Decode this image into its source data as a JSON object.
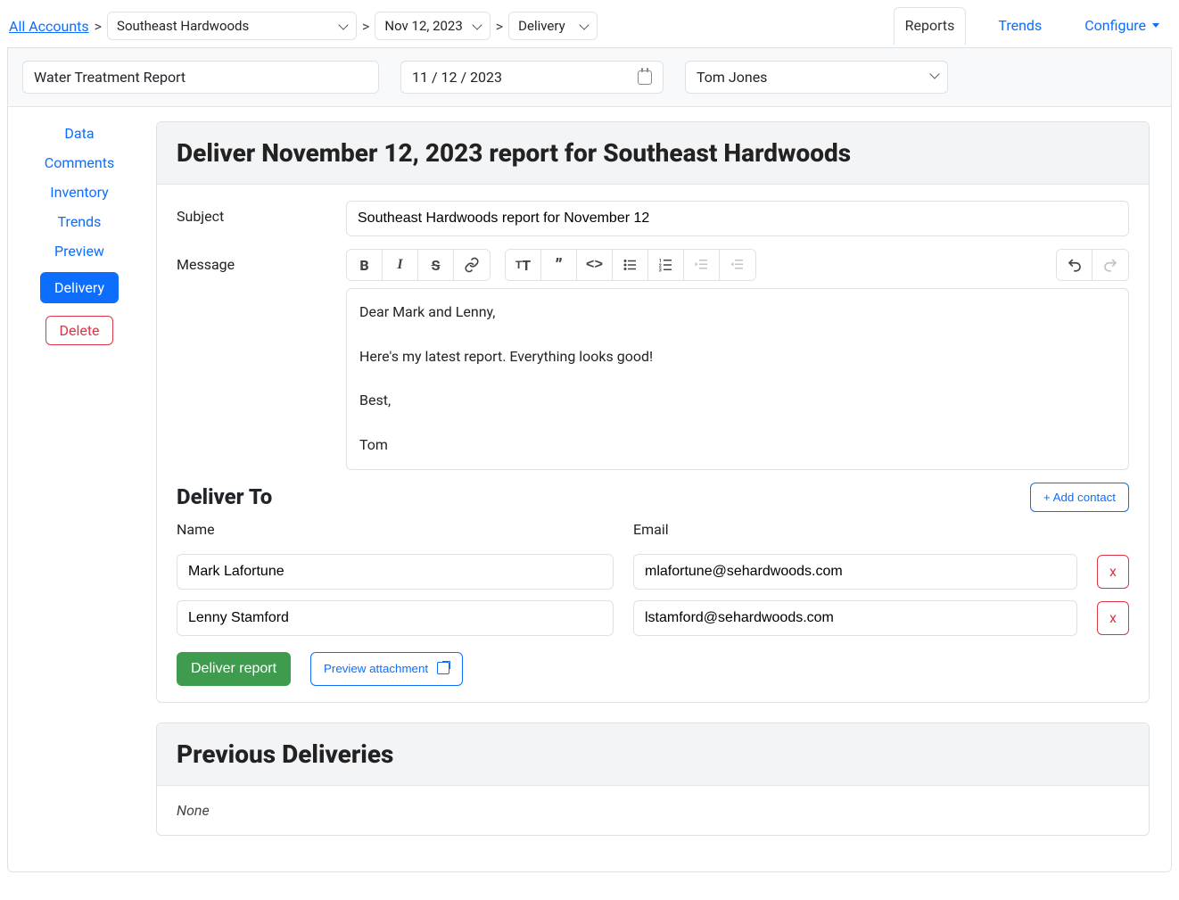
{
  "breadcrumb": {
    "root": "All Accounts",
    "account_select": "Southeast Hardwoods",
    "date_select": "Nov 12, 2023",
    "section_select": "Delivery"
  },
  "tabs": {
    "reports": "Reports",
    "trends": "Trends",
    "configure": "Configure"
  },
  "controls": {
    "report_name": "Water Treatment Report",
    "report_date": "11 / 12 / 2023",
    "assignee": "Tom Jones"
  },
  "sidebar": {
    "data": "Data",
    "comments": "Comments",
    "inventory": "Inventory",
    "trends": "Trends",
    "preview": "Preview",
    "delivery": "Delivery",
    "delete": "Delete"
  },
  "deliver_card": {
    "title": "Deliver November 12, 2023 report for Southeast Hardwoods",
    "subject_label": "Subject",
    "subject_value": "Southeast Hardwoods report for November 12",
    "message_label": "Message",
    "message_body": "Dear Mark and Lenny,\n\nHere's my latest report. Everything looks good!\n\nBest,\n\nTom"
  },
  "deliver_to": {
    "heading": "Deliver To",
    "add_contact": "+ Add contact",
    "name_label": "Name",
    "email_label": "Email",
    "recipients": [
      {
        "name": "Mark Lafortune",
        "email": "mlafortune@sehardwoods.com"
      },
      {
        "name": "Lenny Stamford",
        "email": "lstamford@sehardwoods.com"
      }
    ],
    "remove_label": "x",
    "deliver_btn": "Deliver report",
    "preview_btn": "Preview attachment"
  },
  "previous": {
    "title": "Previous Deliveries",
    "none": "None"
  }
}
